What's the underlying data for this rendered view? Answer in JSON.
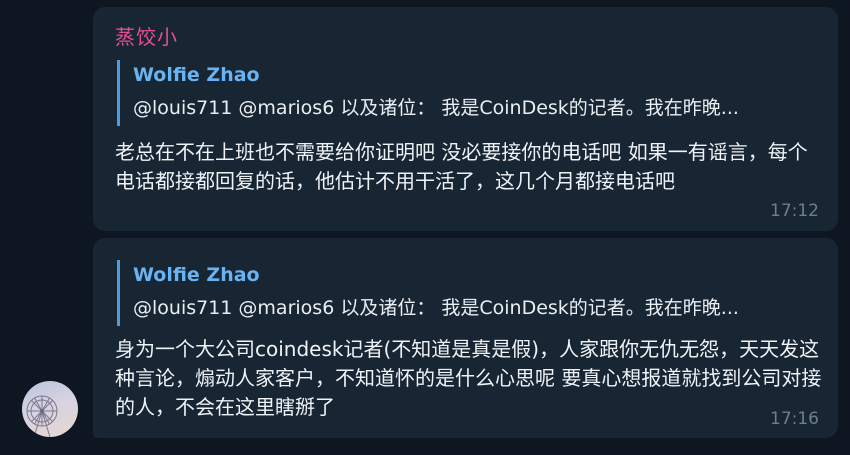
{
  "messages": [
    {
      "sender": "蒸饺小",
      "reply": {
        "name": "Wolfie Zhao",
        "text": "@louis711 @marios6 以及诸位： 我是CoinDesk的记者。我在昨晚..."
      },
      "text": "老总在不在上班也不需要给你证明吧 没必要接你的电话吧 如果一有谣言，每个电话都接都回复的话，他估计不用干活了，这几个月都接电话吧",
      "time": "17:12"
    },
    {
      "reply": {
        "name": "Wolfie Zhao",
        "text": "@louis711 @marios6 以及诸位： 我是CoinDesk的记者。我在昨晚..."
      },
      "text": "身为一个大公司coindesk记者(不知道是真是假)，人家跟你无仇无怨，天天发这种言论，煽动人家客户，不知道怀的是什么心思呢 要真心想报道就找到公司对接的人，不会在这里瞎掰了",
      "time": "17:16"
    }
  ],
  "colors": {
    "background": "#0e1621",
    "bubble": "#182533",
    "sender_name": "#e4508f",
    "reply_accent": "#6ab3f3",
    "timestamp": "#6d7f8f"
  },
  "icons": {
    "avatar": "ferris-wheel-photo"
  }
}
